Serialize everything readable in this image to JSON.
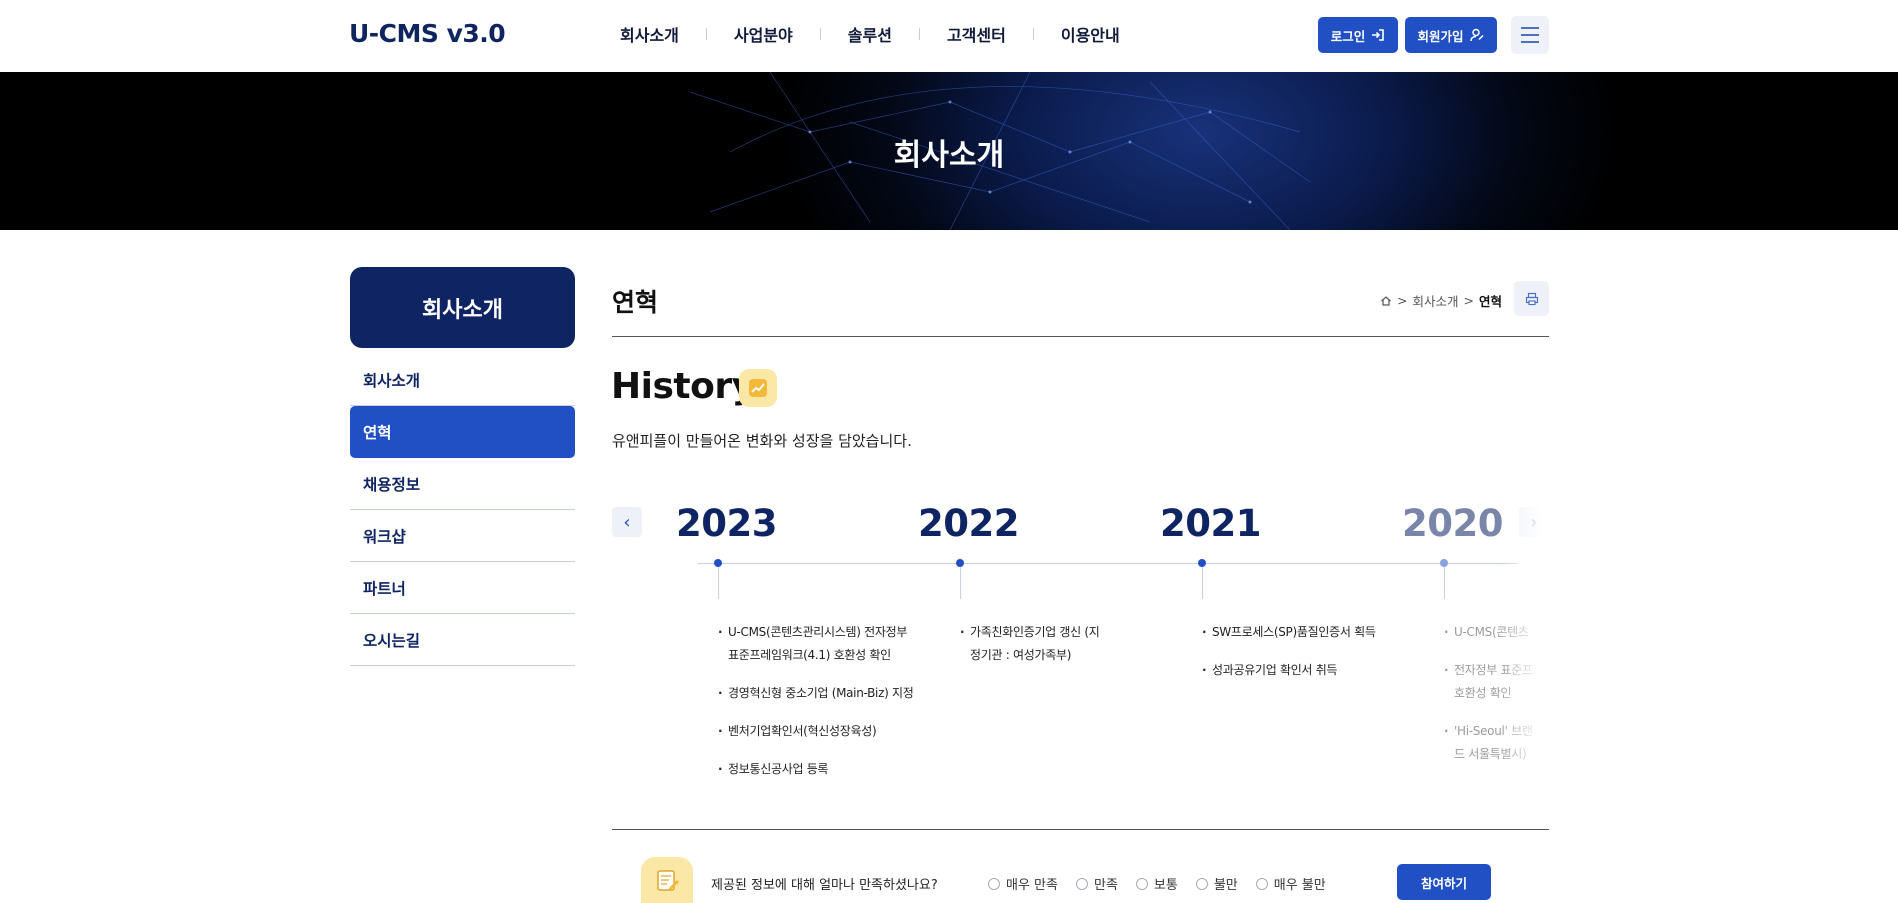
{
  "header": {
    "logo": "U-CMS v3.0",
    "nav": [
      "회사소개",
      "사업분야",
      "솔루션",
      "고객센터",
      "이용안내"
    ],
    "login_label": "로그인",
    "join_label": "회원가입"
  },
  "banner": {
    "title": "회사소개"
  },
  "lnb": {
    "title": "회사소개",
    "items": [
      "회사소개",
      "연혁",
      "채용정보",
      "워크샵",
      "파트너",
      "오시는길"
    ],
    "active_index": 1
  },
  "content": {
    "page_title": "연혁",
    "breadcrumb": [
      "회사소개",
      "연혁"
    ],
    "history_heading": "History",
    "history_sub": "유앤피플이 만들어온 변화와 성장을 담았습니다."
  },
  "timeline": [
    {
      "year": "2023",
      "events": [
        "U-CMS(콘텐츠관리시스템) 전자정부 표준프레임워크(4.1) 호환성 확인",
        "경영혁신형 중소기업 (Main-Biz) 지정",
        "벤처기업확인서(혁신성장육성)",
        "정보통신공사업 등록"
      ]
    },
    {
      "year": "2022",
      "events": [
        "가족친화인증기업 갱신 (지정기관 : 여성가족부)"
      ]
    },
    {
      "year": "2021",
      "events": [
        "SW프로세스(SP)품질인증서 획득",
        "성과공유기업 확인서 취득"
      ]
    },
    {
      "year": "2020",
      "events": [
        "U-CMS(콘텐츠",
        "전자정부 표준프 호환성 확인",
        "'Hi-Seoul' 브랜드 서울특별시)"
      ]
    }
  ],
  "survey": {
    "question": "제공된 정보에 대해 얼마나 만족하셨나요?",
    "options": [
      "매우 만족",
      "만족",
      "보통",
      "불만",
      "매우 불만"
    ],
    "submit_label": "참여하기"
  }
}
